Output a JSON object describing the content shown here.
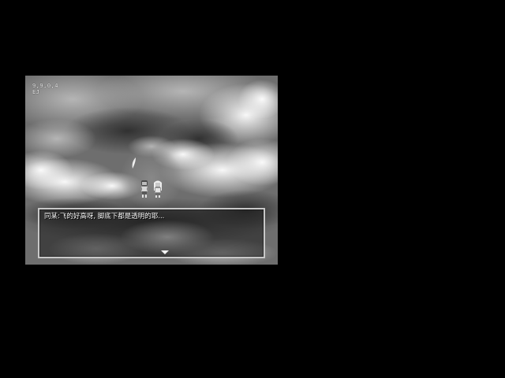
{
  "hud": {
    "debug_line1": "9,9,0,4",
    "debug_line2": "EJ"
  },
  "dialog": {
    "message": "同某:飞的好高呀, 脚底下都是透明的耶..."
  },
  "icons": {
    "advance": "next-arrow-icon",
    "sprite_left": "character-sprite",
    "sprite_right": "character-sprite",
    "feather": "feather-icon"
  },
  "colors": {
    "background": "#000000",
    "window_border": "#c8c8c8",
    "text": "#f4f4f4"
  }
}
